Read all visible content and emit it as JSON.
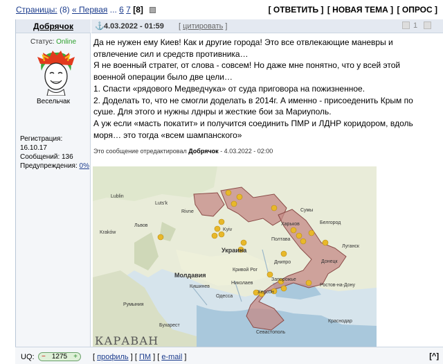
{
  "nav": {
    "pages_label": "Страницы:",
    "pages_count": "(8)",
    "first": "« Первая",
    "ellipsis": "...",
    "p6": "6",
    "p7": "7",
    "current": "[8]",
    "reply": "[ ОТВЕТИТЬ ]",
    "new_topic": "[ НОВАЯ ТЕМА ]",
    "poll": "[ ОПРОС ]"
  },
  "author": {
    "nick": "Добрячок",
    "status_label": "Статус:",
    "status_value": "Online",
    "rank": "Весельчак",
    "registration": "Регистрация: 16.10.17",
    "messages": "Сообщений: 136",
    "warnings_label": "Предупреждения:",
    "warnings_value": "0%"
  },
  "post": {
    "anchor": "⚓",
    "date": "4.03.2022 - 01:59",
    "quote": "цитировать",
    "vote_count": "1",
    "lines": [
      "Да не нужен ему Киев! Как и другие города! Это все отвлекающие маневры и",
      "отвлечение сил и средств противника…",
      "Я не военный стратег, от слова - совсем! Но даже мне понятно, что у всей этой",
      "военной операции было две цели…",
      "1. Спасти «рядового Медведчука» от суда приговора на пожизненное.",
      "2. Доделать то, что не смогли доделать в 2014г. А именно - присоеденить Крым по",
      "суше. Для этого и нужны лднры и жесткие бои за Мариуполь.",
      "А уж если «масть покатит» и получится соединить ПМР и ЛДНР коридором, вдоль",
      "моря… это тогда «всем шампанского»"
    ],
    "edited_prefix": "Это сообщение отредактировал",
    "edited_user": "Добрячок",
    "edited_suffix": "- 4.03.2022 - 02:00"
  },
  "map": {
    "watermark": "КАРАВАН",
    "labels": [
      "Lublin",
      "Luts'k",
      "Rivne",
      "Kyiv",
      "Харьков",
      "Полтава",
      "Украина",
      "Днипро",
      "Кривой Рог",
      "Запорожье",
      "Донецк",
      "Ростов-на-Дону",
      "Николаев",
      "Одесса",
      "Молдавия",
      "Херсон",
      "Краснодар",
      "Севастополь",
      "Бухарест",
      "Румыния",
      "Сумы",
      "Белгород",
      "Луганск",
      "Кишинев",
      "Kraków",
      "Львов"
    ]
  },
  "footer": {
    "uq_label": "UQ:",
    "uq_minus": "−",
    "uq_value": "1275",
    "uq_plus": "+",
    "profile": "профиль",
    "pm": "ПМ",
    "email": "e-mail",
    "up": "[^]"
  }
}
